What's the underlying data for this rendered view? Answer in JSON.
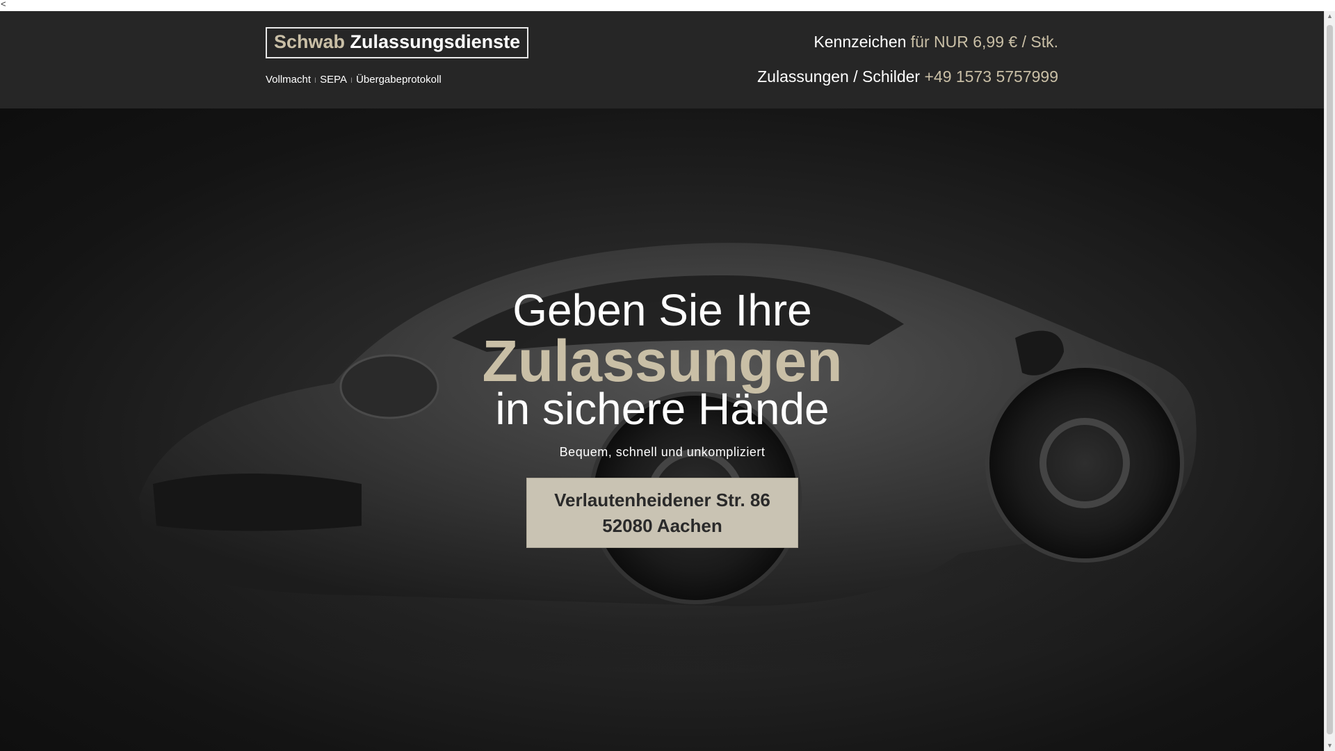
{
  "stray_char": "<",
  "header": {
    "brand_first": "Schwab",
    "brand_second": "Zulassungsdienste",
    "nav": [
      "Vollmacht",
      "SEPA",
      "Übergabeprotokoll"
    ],
    "nav_separator": "I",
    "contact_line1_label": "Kennzeichen",
    "contact_line1_value": "für NUR 6,99 € / Stk.",
    "contact_line2_label": "Zulassungen / Schilder",
    "contact_line2_value": "+49 1573 5757999"
  },
  "hero": {
    "line1": "Geben Sie Ihre",
    "line2": "Zulassungen",
    "line3": "in sichere Hände",
    "subtitle": "Bequem, schnell und unkompliziert",
    "address_line1": "Verlautenheidener Str. 86",
    "address_line2": "52080 Aachen"
  },
  "colors": {
    "accent": "#c9bfa6",
    "header_bg": "#262626",
    "button_bg": "#c9c3b3"
  }
}
